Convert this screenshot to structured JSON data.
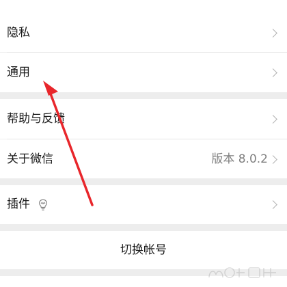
{
  "settings": {
    "privacy_label": "隐私",
    "general_label": "通用",
    "help_feedback_label": "帮助与反馈",
    "about_label": "关于微信",
    "about_value": "版本 8.0.2",
    "plugins_label": "插件",
    "switch_account_label": "切换帐号"
  },
  "icons": {
    "chevron": "chevron-right-icon",
    "plugin": "lightbulb-icon"
  },
  "annotation": {
    "arrow_color": "#e8262b"
  }
}
